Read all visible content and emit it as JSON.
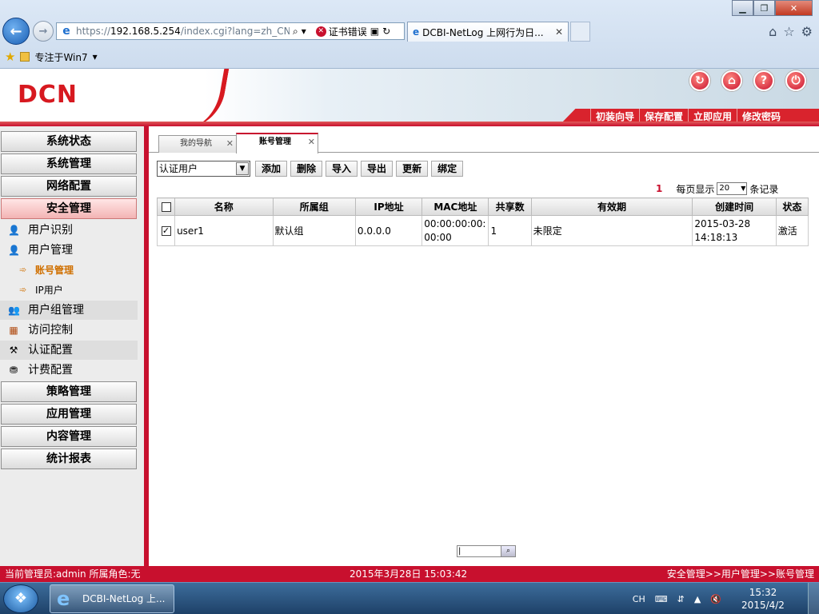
{
  "browser": {
    "url_prefix": "https://",
    "url_host": "192.168.5.254",
    "url_rest": "/index.cgi?lang=zh_CN.U",
    "cert_error": "证书错误",
    "tab_title": "DCBI-NetLog 上网行为日...",
    "favorites_item": "专注于Win7"
  },
  "app": {
    "logo": "DCN",
    "top_menu": [
      "初装向导",
      "保存配置",
      "立即应用",
      "修改密码"
    ]
  },
  "sidebar": {
    "main_items": [
      "系统状态",
      "系统管理",
      "网络配置",
      "安全管理"
    ],
    "sub_items": [
      "用户识别",
      "用户管理"
    ],
    "leaf_items": [
      "账号管理",
      "IP用户"
    ],
    "sub_items2": [
      "用户组管理",
      "访问控制",
      "认证配置",
      "计费配置"
    ],
    "main_items2": [
      "策略管理",
      "应用管理",
      "内容管理",
      "统计报表"
    ]
  },
  "content": {
    "tabs": [
      "我的导航",
      "账号管理"
    ],
    "select_value": "认证用户",
    "buttons": [
      "添加",
      "删除",
      "导入",
      "导出",
      "更新",
      "绑定"
    ],
    "pager": {
      "page": "1",
      "per_page_label": "每页显示",
      "per_page_value": "20",
      "suffix": "条记录"
    },
    "table": {
      "headers": [
        "名称",
        "所属组",
        "IP地址",
        "MAC地址",
        "共享数",
        "有效期",
        "创建时间",
        "状态"
      ],
      "rows": [
        {
          "checked": true,
          "name": "user1",
          "group": "默认组",
          "ip": "0.0.0.0",
          "mac": "00:00:00:00:00:00",
          "share": "1",
          "validity": "未限定",
          "created": "2015-03-28 14:18:13",
          "status": "激活"
        }
      ]
    },
    "search_value": "|"
  },
  "statusbar": {
    "admin": "当前管理员:admin  所属角色:无",
    "datetime": "2015年3月28日 15:03:42",
    "breadcrumb": "安全管理>>用户管理>>账号管理"
  },
  "taskbar": {
    "task_label": "DCBI-NetLog 上...",
    "lang": "CH",
    "time": "15:32",
    "date": "2015/4/2"
  },
  "colors": {
    "brand_red": "#c8102e",
    "active_leaf": "#d07000"
  }
}
